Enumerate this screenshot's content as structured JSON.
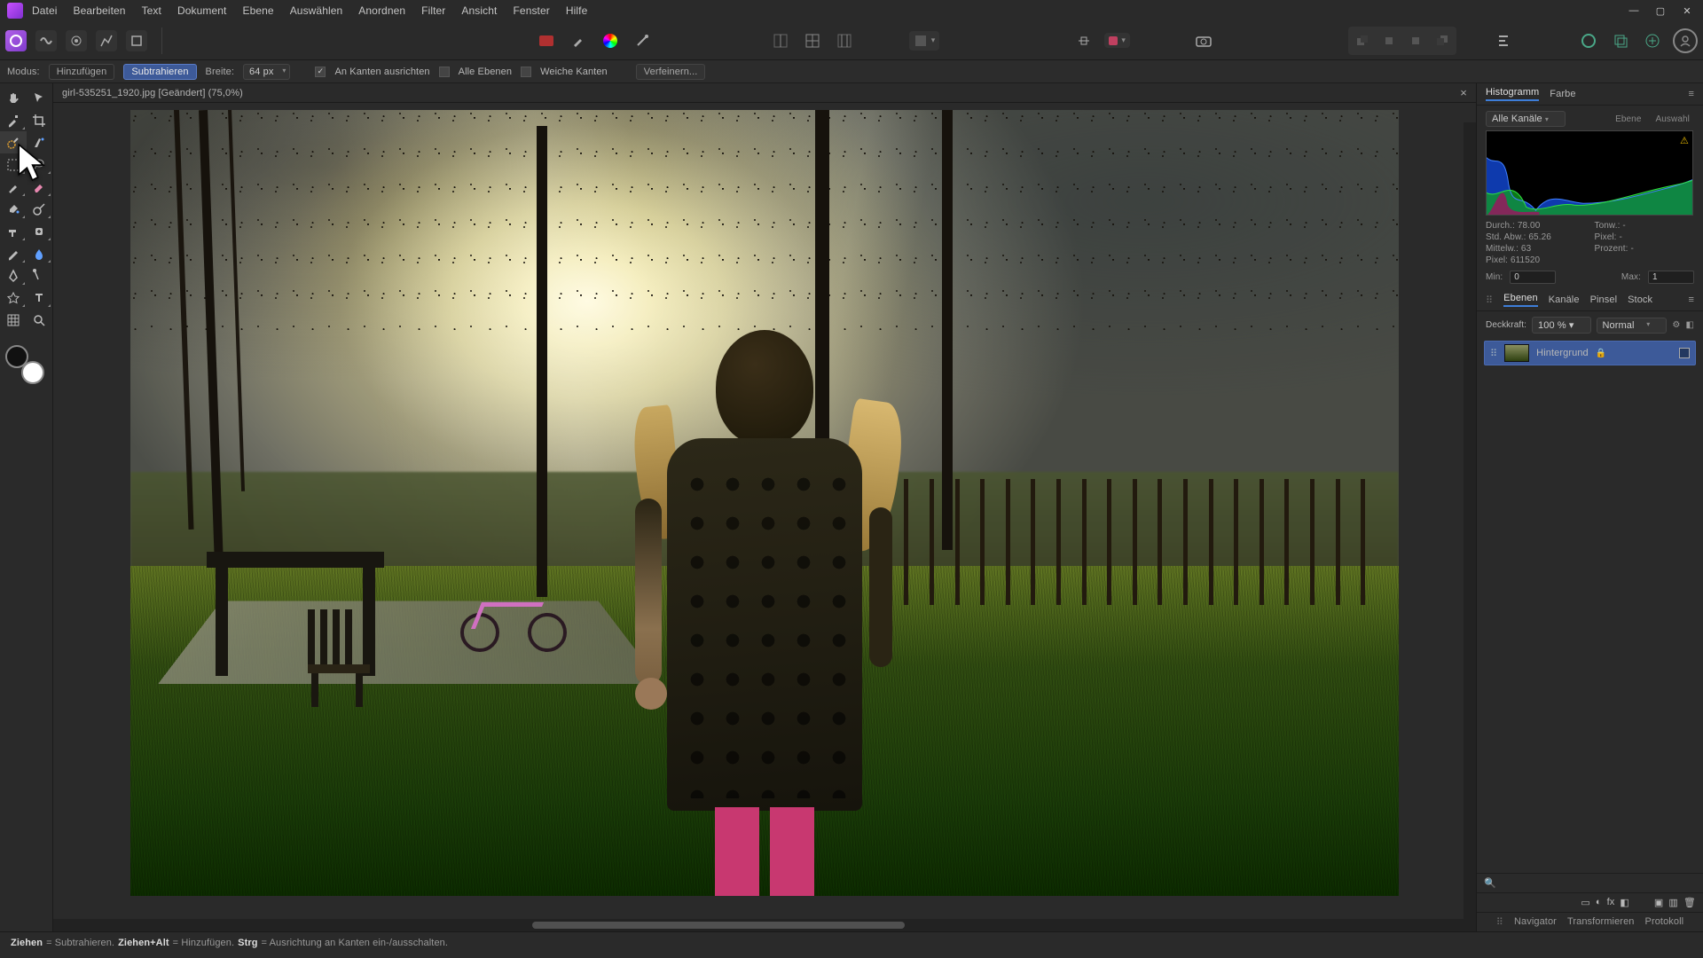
{
  "menu": {
    "items": [
      "Datei",
      "Bearbeiten",
      "Text",
      "Dokument",
      "Ebene",
      "Auswählen",
      "Anordnen",
      "Filter",
      "Ansicht",
      "Fenster",
      "Hilfe"
    ]
  },
  "context": {
    "mode_label": "Modus:",
    "add": "Hinzufügen",
    "sub": "Subtrahieren",
    "width_label": "Breite:",
    "width_value": "64 px",
    "snap": "An Kanten ausrichten",
    "all_layers": "Alle Ebenen",
    "soft_edges": "Weiche Kanten",
    "refine": "Verfeinern..."
  },
  "doc": {
    "title": "girl-535251_1920.jpg [Geändert] (75,0%)"
  },
  "histogram": {
    "tab1": "Histogramm",
    "tab2": "Farbe",
    "channels": "Alle Kanäle",
    "btn_layer": "Ebene",
    "btn_sel": "Auswahl",
    "mean_label": "Durch.:",
    "mean_val": "78.00",
    "sd_label": "Std. Abw.:",
    "sd_val": "65.26",
    "med_label": "Mittelw.:",
    "med_val": "63",
    "px_label": "Pixel:",
    "px_val": "611520",
    "tone_label": "Tonw.:",
    "tone_val": "-",
    "pix2_label": "Pixel:",
    "pix2_val": "-",
    "pct_label": "Prozent:",
    "pct_val": "-",
    "min_label": "Min:",
    "min_val": "0",
    "max_label": "Max:",
    "max_val": "1"
  },
  "layers": {
    "tabs": {
      "ebenen": "Ebenen",
      "kanale": "Kanäle",
      "pinsel": "Pinsel",
      "stock": "Stock"
    },
    "opacity_label": "Deckkraft:",
    "opacity_val": "100 %",
    "blend": "Normal",
    "layer1": "Hintergrund"
  },
  "collapsed": {
    "nav": "Navigator",
    "trans": "Transformieren",
    "proto": "Protokoll"
  },
  "status": {
    "s1": "Ziehen",
    "s1d": " = Subtrahieren. ",
    "s2": "Ziehen+Alt",
    "s2d": " = Hinzufügen. ",
    "s3": "Strg",
    "s3d": " = Ausrichtung an Kanten ein-/ausschalten."
  }
}
